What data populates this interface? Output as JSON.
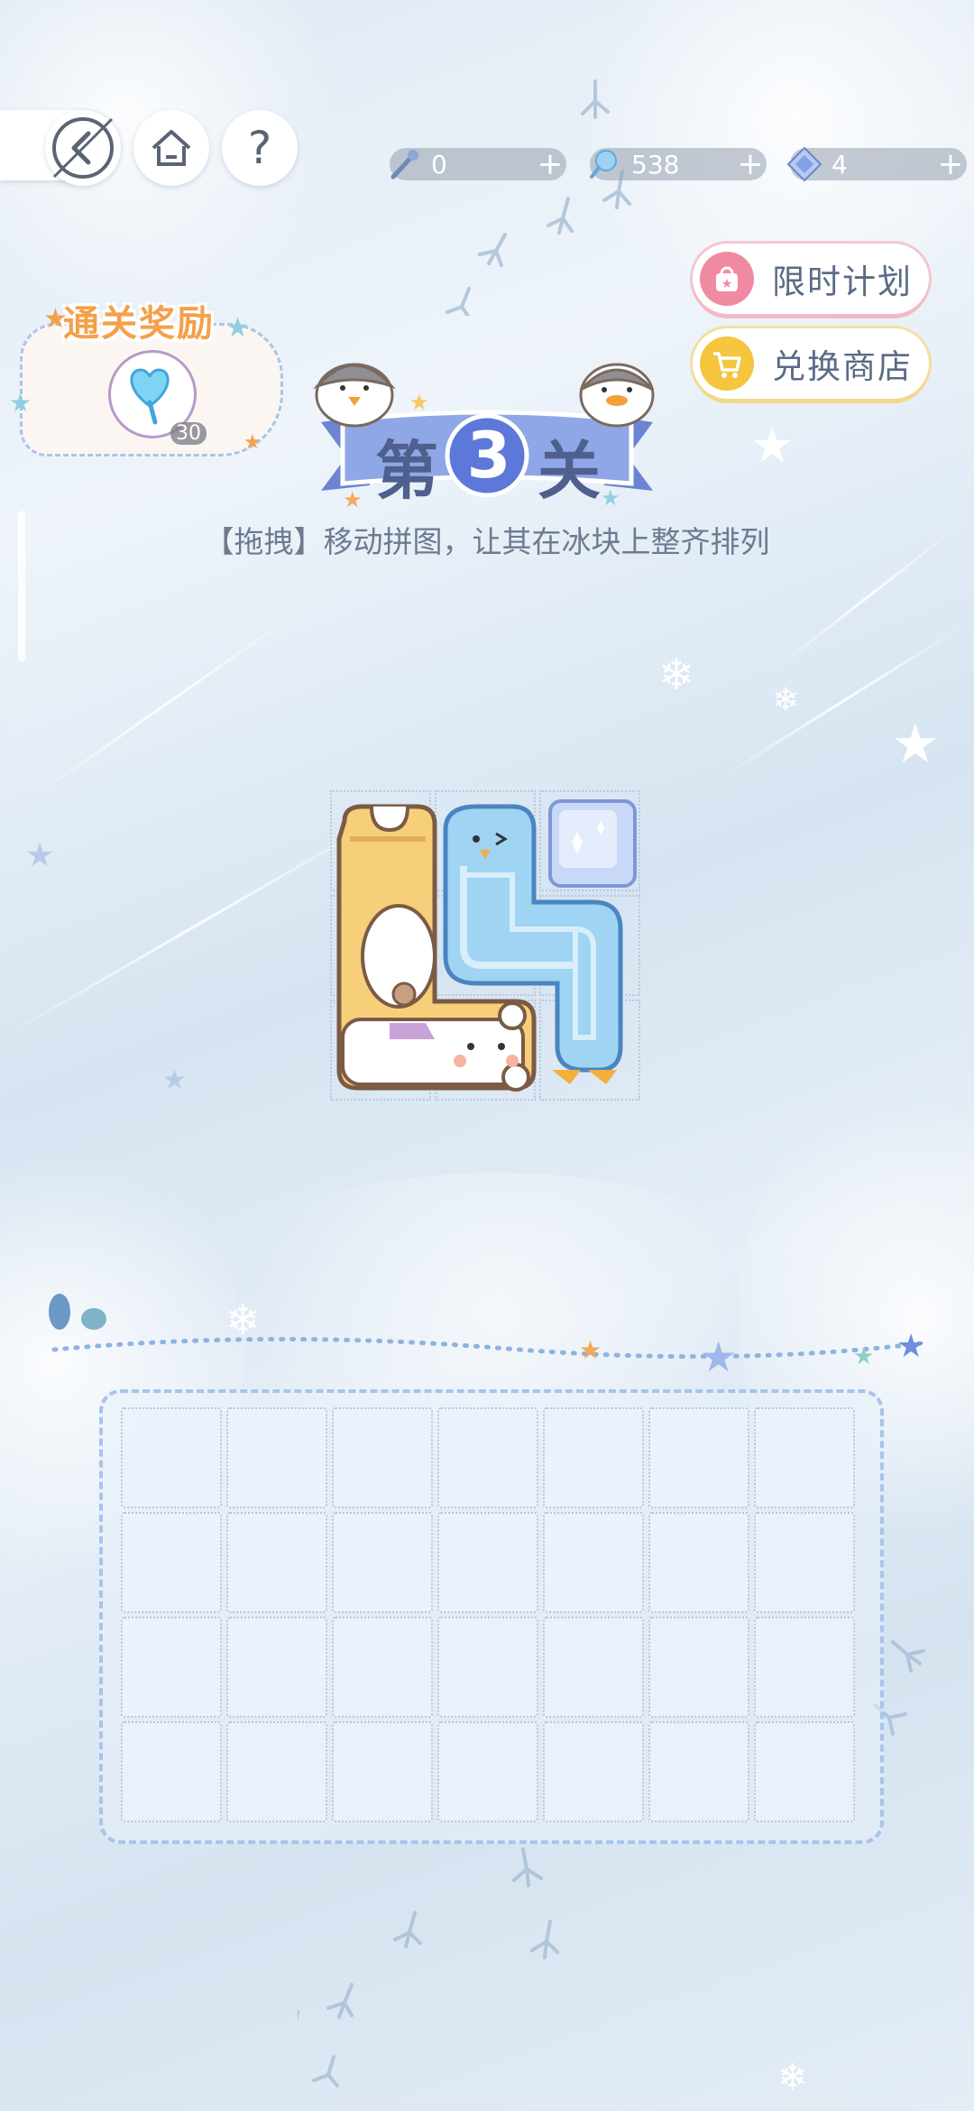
{
  "header": {
    "resources": [
      {
        "icon": "feather-icon",
        "value": "0",
        "plus": "+"
      },
      {
        "icon": "lollipop-icon",
        "value": "538",
        "plus": "+"
      },
      {
        "icon": "gem-icon",
        "value": "4",
        "plus": "+"
      }
    ],
    "help_label": "?"
  },
  "side_buttons": {
    "limited_plan": "限时计划",
    "exchange_shop": "兑换商店"
  },
  "reward": {
    "title": "通关奖励",
    "count": "30"
  },
  "level": {
    "prefix": "第",
    "number": "3",
    "suffix": "关",
    "instruction": "【拖拽】移动拼图，让其在冰块上整齐排列"
  },
  "target_grid": {
    "rows": 4,
    "cols": 7
  },
  "colors": {
    "accent": "#4f5f8e",
    "banner": "#7d97de",
    "reward_title": "#f5a04a"
  }
}
